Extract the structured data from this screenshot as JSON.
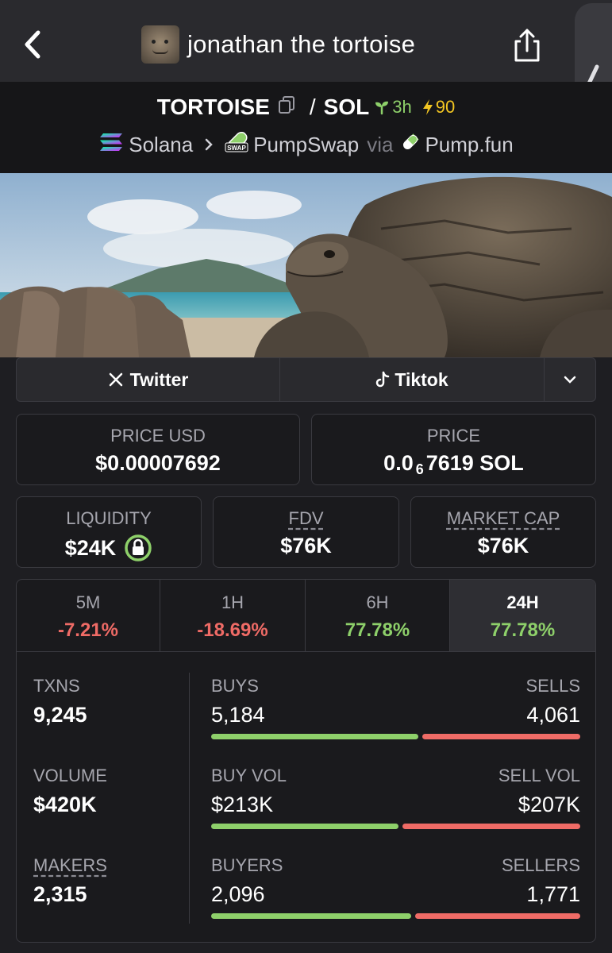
{
  "header": {
    "title": "jonathan the tortoise",
    "back_icon": "chevron-left-icon",
    "share_icon": "share-icon"
  },
  "pair": {
    "base": "TORTOISE",
    "separator": "/",
    "quote": "SOL",
    "age": "3h",
    "boosts": "90",
    "chain": "Solana",
    "dex": "PumpSwap",
    "via": "via",
    "launchpad": "Pump.fun"
  },
  "social": {
    "twitter": "Twitter",
    "tiktok": "Tiktok"
  },
  "price": {
    "usd_label": "PRICE USD",
    "usd_value": "$0.00007692",
    "native_label": "PRICE",
    "native_prefix": "0.0",
    "native_zeros": "6",
    "native_rest": "7619 SOL"
  },
  "metrics": {
    "liquidity_label": "LIQUIDITY",
    "liquidity_value": "$24K",
    "fdv_label": "FDV",
    "fdv_value": "$76K",
    "mcap_label": "MARKET CAP",
    "mcap_value": "$76K"
  },
  "changes": [
    {
      "period": "5M",
      "pct": "-7.21%",
      "dir": "neg"
    },
    {
      "period": "1H",
      "pct": "-18.69%",
      "dir": "neg"
    },
    {
      "period": "6H",
      "pct": "77.78%",
      "dir": "pos"
    },
    {
      "period": "24H",
      "pct": "77.78%",
      "dir": "pos"
    }
  ],
  "stats": {
    "txns_label": "TXNS",
    "txns_value": "9,245",
    "buys_label": "BUYS",
    "buys_value": "5,184",
    "sells_label": "SELLS",
    "sells_value": "4,061",
    "buys_ratio": 0.561,
    "volume_label": "VOLUME",
    "volume_value": "$420K",
    "buyvol_label": "BUY VOL",
    "buyvol_value": "$213K",
    "sellvol_label": "SELL VOL",
    "sellvol_value": "$207K",
    "buyvol_ratio": 0.507,
    "makers_label": "MAKERS",
    "makers_value": "2,315",
    "buyers_label": "BUYERS",
    "buyers_value": "2,096",
    "sellers_label": "SELLERS",
    "sellers_value": "1,771",
    "buyers_ratio": 0.542
  },
  "colors": {
    "positive": "#8ed06a",
    "negative": "#ef6b66",
    "boost": "#f3c622"
  }
}
